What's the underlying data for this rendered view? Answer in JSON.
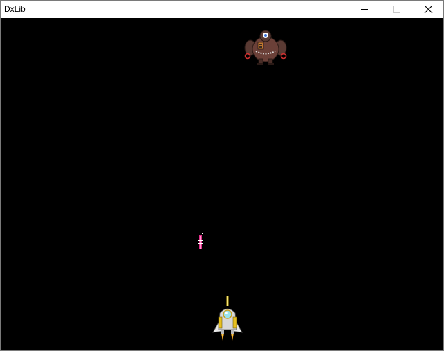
{
  "window": {
    "title": "DxLib"
  },
  "caption_buttons": {
    "minimize_icon": "minimize-icon",
    "maximize_icon": "maximize-icon",
    "close_icon": "close-icon"
  },
  "game": {
    "background_color": "#000000",
    "enemy_icon": "robot-boss-enemy-icon",
    "bullet_icon": "pink-laser-bullet-icon",
    "player_icon": "player-spaceship-icon"
  }
}
